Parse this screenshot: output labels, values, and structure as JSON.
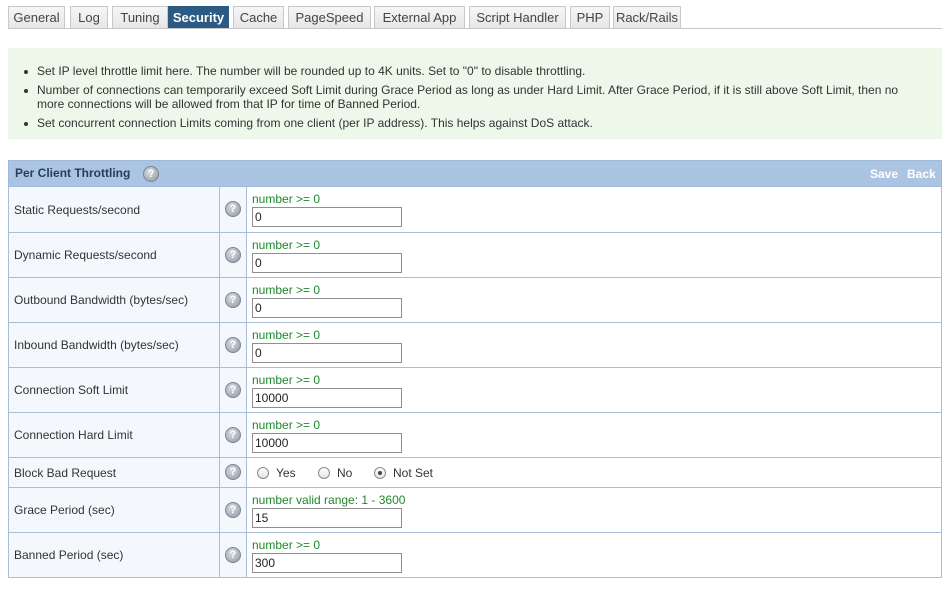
{
  "tabs": [
    {
      "label": "General",
      "active": false
    },
    {
      "label": "Log",
      "active": false
    },
    {
      "label": "Tuning",
      "active": false
    },
    {
      "label": "Security",
      "active": true
    },
    {
      "label": "Cache",
      "active": false
    },
    {
      "label": "PageSpeed",
      "active": false
    },
    {
      "label": "External App",
      "active": false
    },
    {
      "label": "Script Handler",
      "active": false
    },
    {
      "label": "PHP",
      "active": false
    },
    {
      "label": "Rack/Rails",
      "active": false
    }
  ],
  "info": {
    "items": [
      "Set IP level throttle limit here. The number will be rounded up to 4K units. Set to \"0\" to disable throttling.",
      "Number of connections can temporarily exceed Soft Limit during Grace Period as long as under Hard Limit. After Grace Period, if it is still above Soft Limit, then no more connections will be allowed from that IP for time of Banned Period.",
      "Set concurrent connection Limits coming from one client (per IP address). This helps against DoS attack."
    ]
  },
  "panel": {
    "title": "Per Client Throttling",
    "save_label": "Save",
    "back_label": "Back",
    "help_glyph": "?"
  },
  "rows": [
    {
      "label": "Static Requests/second",
      "hint": "number >= 0",
      "value": "0"
    },
    {
      "label": "Dynamic Requests/second",
      "hint": "number >= 0",
      "value": "0"
    },
    {
      "label": "Outbound Bandwidth (bytes/sec)",
      "hint": "number >= 0",
      "value": "0"
    },
    {
      "label": "Inbound Bandwidth (bytes/sec)",
      "hint": "number >= 0",
      "value": "0"
    },
    {
      "label": "Connection Soft Limit",
      "hint": "number >= 0",
      "value": "10000"
    },
    {
      "label": "Connection Hard Limit",
      "hint": "number >= 0",
      "value": "10000"
    },
    {
      "label": "Block Bad Request",
      "options": [
        "Yes",
        "No",
        "Not Set"
      ],
      "selected": "Not Set"
    },
    {
      "label": "Grace Period (sec)",
      "hint": "number valid range: 1 - 3600",
      "value": "15"
    },
    {
      "label": "Banned Period (sec)",
      "hint": "number >= 0",
      "value": "300"
    }
  ],
  "colors": {
    "active_tab": "#2b5a83",
    "info_background": "#edf8ea",
    "panel_header": "#aac4e2",
    "hint_text": "#1d8a2a"
  },
  "icons": {
    "help": "help-icon"
  }
}
